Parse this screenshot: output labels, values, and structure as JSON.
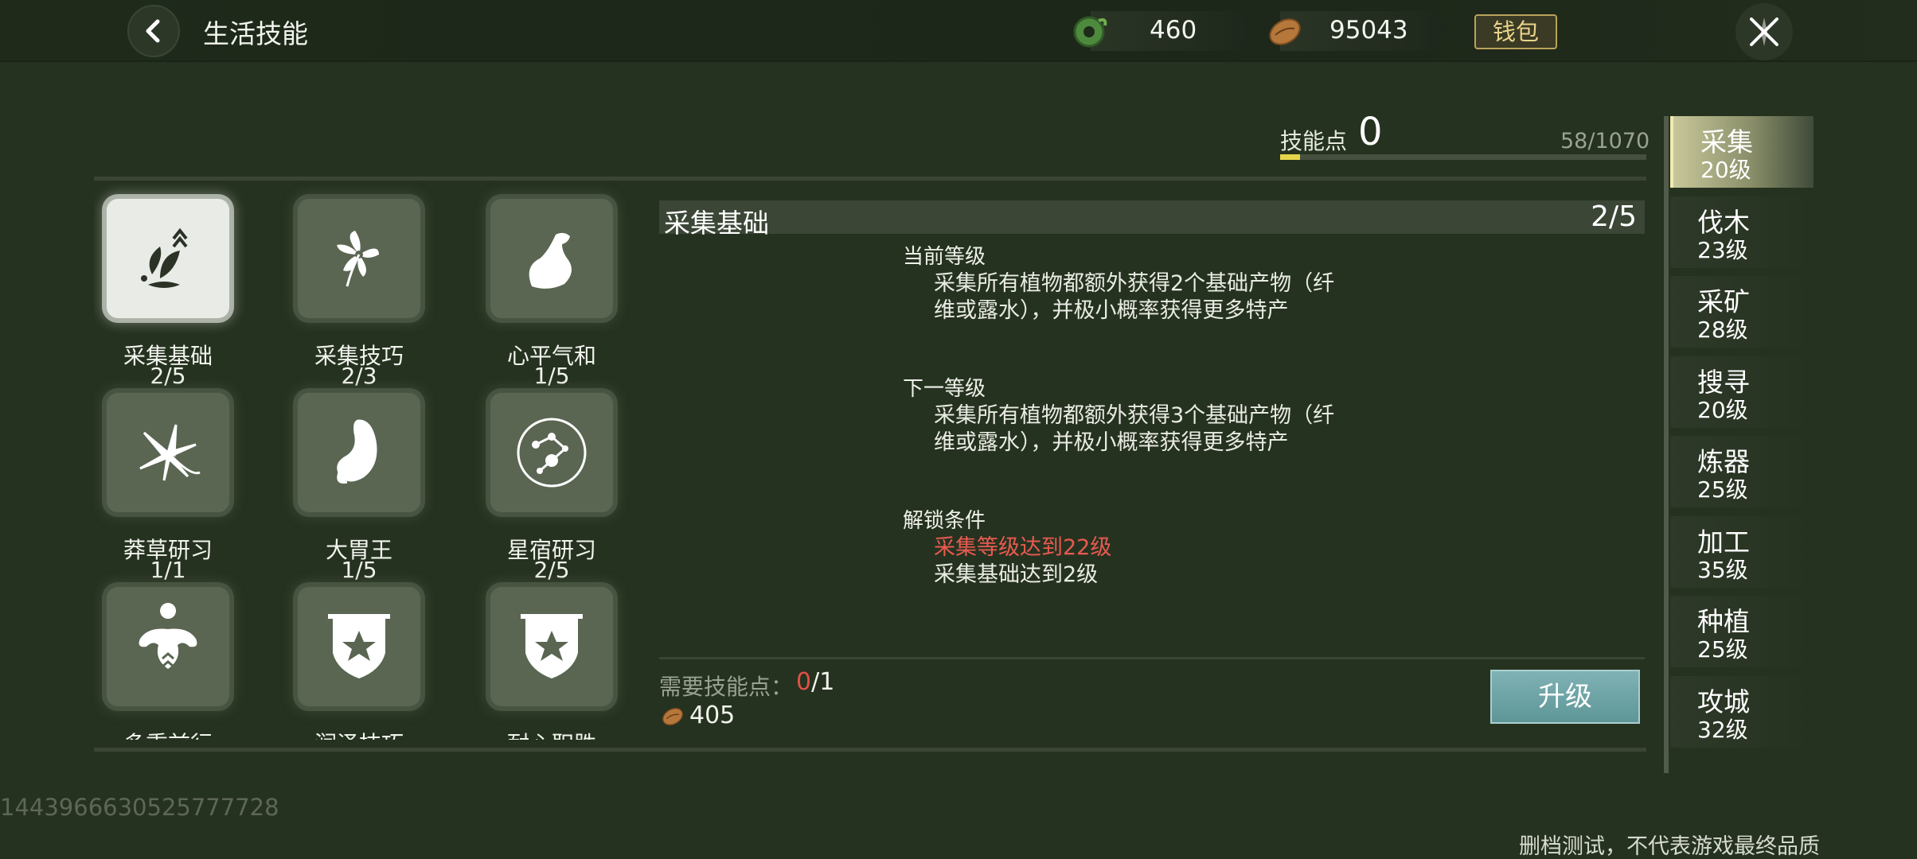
{
  "header": {
    "title": "生活技能",
    "currency_jade": "460",
    "currency_beans": "95043",
    "wallet_label": "钱包"
  },
  "skill_points": {
    "label": "技能点",
    "value": "0",
    "progress_text": "58/1070",
    "progress_fraction": 0.054
  },
  "skills": [
    {
      "name": "采集基础",
      "level": "2/5",
      "icon": "herb-upgrade-icon",
      "selected": true
    },
    {
      "name": "采集技巧",
      "level": "2/3",
      "icon": "flower-icon"
    },
    {
      "name": "心平气和",
      "level": "1/5",
      "icon": "flexed-arm-icon"
    },
    {
      "name": "莽草研习",
      "level": "1/1",
      "icon": "grass-leaf-icon"
    },
    {
      "name": "大胃王",
      "level": "1/5",
      "icon": "stomach-icon"
    },
    {
      "name": "星宿研习",
      "level": "2/5",
      "icon": "constellation-icon"
    },
    {
      "name": "多重前行",
      "level": "",
      "icon": "muscle-body-icon"
    },
    {
      "name": "润泽技巧",
      "level": "",
      "icon": "star-banner-icon"
    },
    {
      "name": "耐心职胜",
      "level": "",
      "icon": "star-banner-icon"
    }
  ],
  "detail": {
    "title": "采集基础",
    "level": "2/5",
    "current_label": "当前等级",
    "current_desc_1": "采集所有植物都额外获得2个基础产物（纤",
    "current_desc_2": "维或露水），并极小概率获得更多特产",
    "next_label": "下一等级",
    "next_desc_1": "采集所有植物都额外获得3个基础产物（纤",
    "next_desc_2": "维或露水），并极小概率获得更多特产",
    "unlock_label": "解锁条件",
    "unlock_cond_1": "采集等级达到22级",
    "unlock_cond_2": "采集基础达到2级",
    "cost_label": "需要技能点：",
    "cost_have": "0",
    "cost_need": "/1",
    "bean_cost": "405",
    "upgrade_label": "升级"
  },
  "categories": [
    {
      "name": "采集",
      "level": "20级",
      "active": true
    },
    {
      "name": "伐木",
      "level": "23级"
    },
    {
      "name": "采矿",
      "level": "28级"
    },
    {
      "name": "搜寻",
      "level": "20级"
    },
    {
      "name": "炼器",
      "level": "25级"
    },
    {
      "name": "加工",
      "level": "35级"
    },
    {
      "name": "种植",
      "level": "25级"
    },
    {
      "name": "攻城",
      "level": "32级"
    }
  ],
  "footer": {
    "uid": "1443966630525777728",
    "disclaimer": "删档测试，不代表游戏最终品质"
  },
  "colors": {
    "background": "#263220",
    "warning_red": "#e85a4f",
    "upgrade_teal": "#6fa5a7",
    "progress_yellow": "#e6d44a"
  }
}
